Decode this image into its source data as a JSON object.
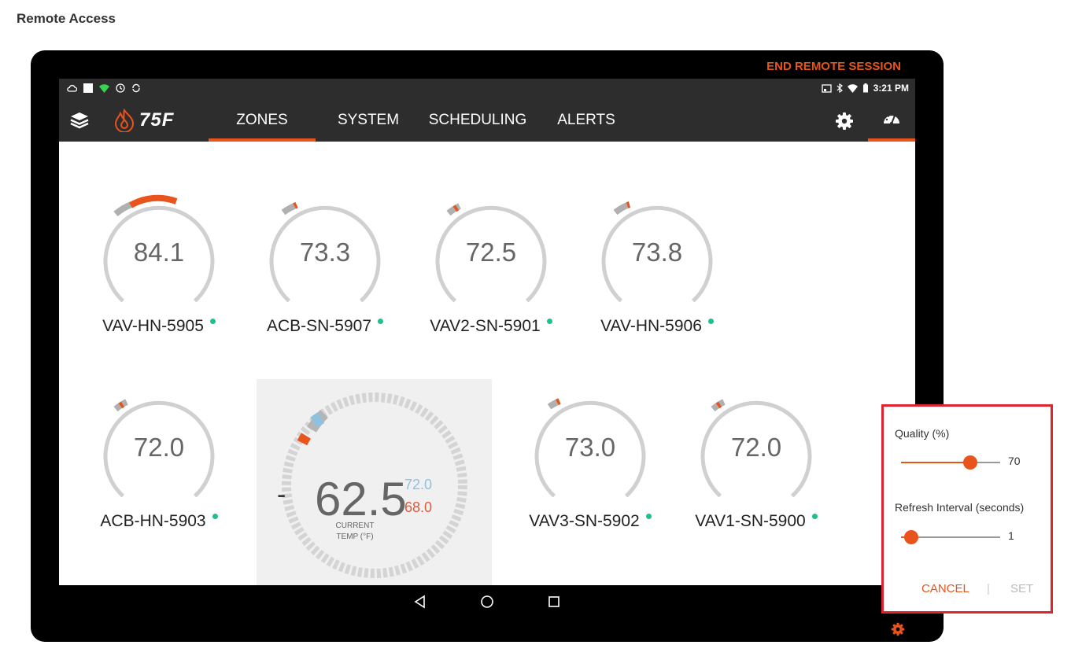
{
  "page": {
    "title": "Remote Access"
  },
  "session": {
    "end_label": "END REMOTE SESSION"
  },
  "statusbar": {
    "time": "3:21 PM"
  },
  "nav": {
    "logo_text": "75F",
    "tabs": [
      {
        "label": "ZONES",
        "active": true
      },
      {
        "label": "SYSTEM",
        "active": false
      },
      {
        "label": "SCHEDULING",
        "active": false
      },
      {
        "label": "ALERTS",
        "active": false
      }
    ]
  },
  "zones": [
    {
      "name": "VAV-HN-5905",
      "temp": "84.1"
    },
    {
      "name": "ACB-SN-5907",
      "temp": "73.3"
    },
    {
      "name": "VAV2-SN-5901",
      "temp": "72.5"
    },
    {
      "name": "VAV-HN-5906",
      "temp": "73.8"
    },
    {
      "name": "ACB-HN-5903",
      "temp": "72.0"
    },
    {
      "name": "VAV3-SN-5902",
      "temp": "73.0"
    },
    {
      "name": "VAV1-SN-5900",
      "temp": "72.0"
    }
  ],
  "selected_zone": {
    "minus": "-",
    "current_temp": "62.5",
    "cooling_setpoint": "72.0",
    "heating_setpoint": "68.0",
    "label_line1": "CURRENT",
    "label_line2": "TEMP (°F)"
  },
  "colors": {
    "accent": "#e8541c",
    "online": "#1fbf8f",
    "cool": "#8ec1e0",
    "highlight": "#e02530"
  },
  "settings_panel": {
    "quality_label": "Quality (%)",
    "quality_value": "70",
    "quality_fraction": 0.7,
    "refresh_label": "Refresh Interval (seconds)",
    "refresh_value": "1",
    "refresh_fraction": 0.1,
    "cancel_label": "CANCEL",
    "separator": "|",
    "set_label": "SET"
  }
}
